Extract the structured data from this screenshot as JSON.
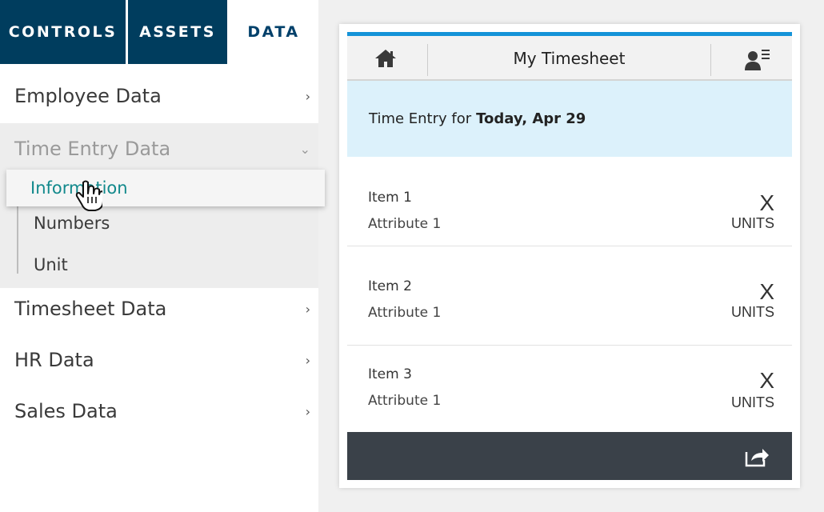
{
  "tabs": [
    {
      "label": "CONTROLS"
    },
    {
      "label": "ASSETS"
    },
    {
      "label": "DATA"
    }
  ],
  "nav": {
    "items": [
      {
        "label": "Employee Data"
      },
      {
        "label": "Time Entry Data"
      },
      {
        "label": "Timesheet Data"
      },
      {
        "label": "HR Data"
      },
      {
        "label": "Sales Data"
      }
    ],
    "sub_items": [
      {
        "label": "Information"
      },
      {
        "label": "Numbers"
      },
      {
        "label": "Unit"
      }
    ],
    "chevron_right": "›",
    "chevron_down": "⌄"
  },
  "phone": {
    "title": "My Timesheet",
    "banner_prefix": "Time Entry for",
    "banner_date": "Today, Apr 29",
    "items": [
      {
        "name": "Item 1",
        "attribute": "Attribute 1",
        "value": "X",
        "unit": "UNITS"
      },
      {
        "name": "Item 2",
        "attribute": "Attribute 1",
        "value": "X",
        "unit": "UNITS"
      },
      {
        "name": "Item 3",
        "attribute": "Attribute 1",
        "value": "X",
        "unit": "UNITS"
      }
    ]
  },
  "colors": {
    "tab_dark": "#003d5e",
    "accent_blue": "#1593d8",
    "banner_bg": "#dcf1fb",
    "link_teal": "#12898c",
    "footer_bg": "#3a4149"
  },
  "icons": [
    "home-icon",
    "person-menu-icon",
    "share-icon",
    "hand-cursor-icon",
    "chevron-right-icon",
    "chevron-down-icon"
  ]
}
